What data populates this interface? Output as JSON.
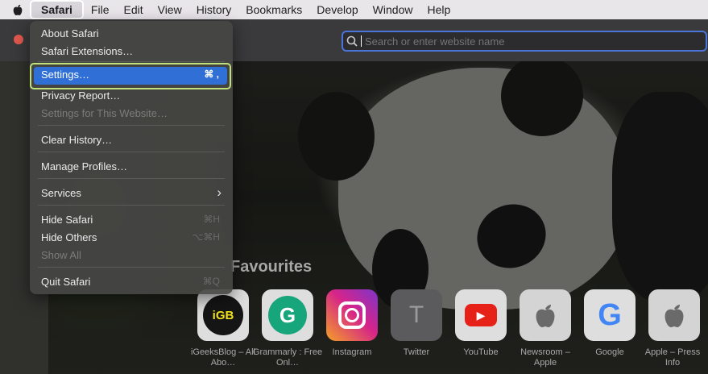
{
  "menubar": {
    "apple_icon": "apple-logo-icon",
    "items": [
      "Safari",
      "File",
      "Edit",
      "View",
      "History",
      "Bookmarks",
      "Develop",
      "Window",
      "Help"
    ]
  },
  "toolbar": {
    "address_placeholder": "Search or enter website name"
  },
  "safari_menu": {
    "about": "About Safari",
    "extensions": "Safari Extensions…",
    "settings": "Settings…",
    "settings_shortcut": "⌘ ,",
    "privacy": "Privacy Report…",
    "settings_for_site": "Settings for This Website…",
    "clear_history": "Clear History…",
    "manage_profiles": "Manage Profiles…",
    "services": "Services",
    "services_arrow": "›",
    "hide_safari": "Hide Safari",
    "hide_safari_shortcut": "⌘H",
    "hide_others": "Hide Others",
    "hide_others_shortcut": "⌥⌘H",
    "show_all": "Show All",
    "quit": "Quit Safari",
    "quit_shortcut": "⌘Q"
  },
  "favourites": {
    "title": "Favourites",
    "items": [
      {
        "label": "iGeeksBlog – All Abo…",
        "glyph": "iGB",
        "color": "#f2e21a"
      },
      {
        "label": "Grammarly : Free Onl…",
        "glyph": "G",
        "color": "#17a57c"
      },
      {
        "label": "Instagram",
        "glyph": "◎",
        "color": "#d6248a"
      },
      {
        "label": "Twitter",
        "glyph": "T",
        "color": "#5b5b5e"
      },
      {
        "label": "YouTube",
        "glyph": "▶",
        "color": "#e62117"
      },
      {
        "label": "Newsroom – Apple",
        "glyph": "",
        "color": "#dcdcdc"
      },
      {
        "label": "Google",
        "glyph": "G",
        "color": "#4285f4"
      },
      {
        "label": "Apple – Press Info",
        "glyph": "",
        "color": "#dcdcdc"
      }
    ]
  }
}
